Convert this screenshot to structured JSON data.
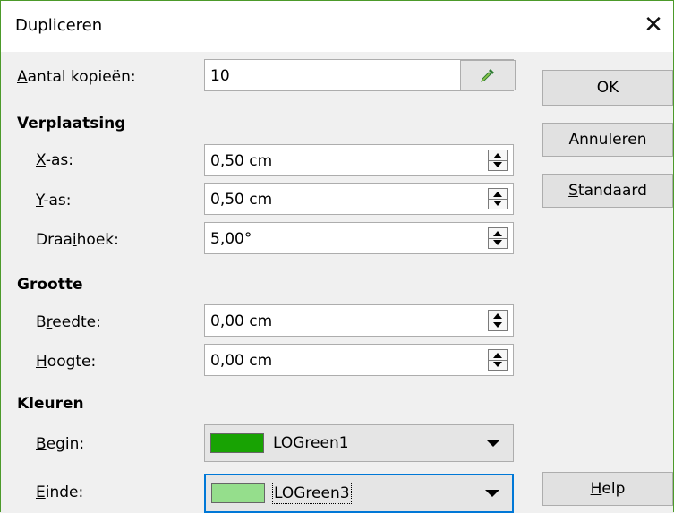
{
  "dialog": {
    "title": "Dupliceren"
  },
  "copies": {
    "label": "Aantal kopieën:",
    "mnemonic": "A",
    "rest": "antal kopieën:",
    "value": "10"
  },
  "placement": {
    "header": "Verplaatsing",
    "x": {
      "label": "X-as:",
      "m": "X",
      "rest": "-as:",
      "value": "0,50 cm"
    },
    "y": {
      "label": "Y-as:",
      "m": "Y",
      "rest": "-as:",
      "value": "0,50 cm"
    },
    "angle": {
      "label": "Draaihoek:",
      "pre": "Draa",
      "m": "i",
      "rest": "hoek:",
      "value": "5,00°"
    }
  },
  "size": {
    "header": "Grootte",
    "width": {
      "label": "Breedte:",
      "pre": "B",
      "m": "r",
      "rest": "eedte:",
      "value": "0,00 cm"
    },
    "height": {
      "label": "Hoogte:",
      "m": "H",
      "rest": "oogte:",
      "value": "0,00 cm"
    }
  },
  "colors": {
    "header": "Kleuren",
    "start": {
      "label": "Begin:",
      "m": "B",
      "rest": "egin:",
      "value": "LOGreen1",
      "swatch": "#18a303"
    },
    "end": {
      "label": "Einde:",
      "m": "E",
      "rest": "inde:",
      "value": "LOGreen3",
      "swatch": "#95de8c"
    }
  },
  "buttons": {
    "ok": "OK",
    "cancel": "Annuleren",
    "default": {
      "m": "S",
      "rest": "tandaard"
    },
    "help": {
      "m": "H",
      "rest": "elp"
    }
  },
  "theme": {
    "focus": "#0078d7",
    "window_border": "#4c9a2a"
  }
}
